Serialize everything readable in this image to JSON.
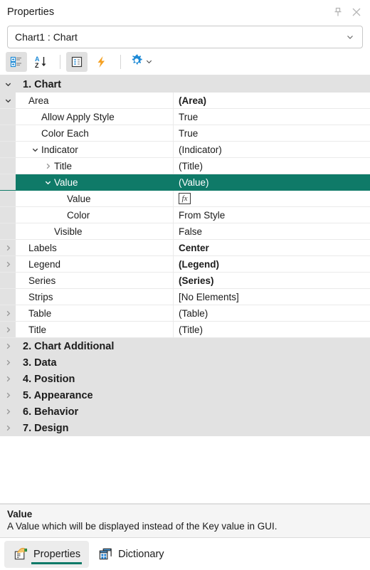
{
  "window": {
    "title": "Properties",
    "pin_icon": "pin-icon",
    "close_icon": "close-icon"
  },
  "object_selector": {
    "value": "Chart1 : Chart",
    "arrow_icon": "chevron-down-icon"
  },
  "toolbar": {
    "buttons": [
      {
        "name": "categorized-view",
        "icon": "categorized-list-icon",
        "active": true
      },
      {
        "name": "alphabetical-sort",
        "icon": "sort-az-icon",
        "active": false
      },
      {
        "name": "properties-view",
        "icon": "properties-list-icon",
        "active": true
      },
      {
        "name": "events-view",
        "icon": "lightning-icon",
        "active": false
      },
      {
        "name": "settings",
        "icon": "gear-icon",
        "active": false
      }
    ]
  },
  "grid": {
    "rows": [
      {
        "type": "category",
        "label": "1. Chart",
        "expanded": true
      },
      {
        "type": "prop",
        "indent": 0,
        "twisty": "expanded",
        "name": "Area",
        "value": "(Area)",
        "bold": true
      },
      {
        "type": "prop",
        "indent": 1,
        "twisty": "none",
        "name": "Allow Apply Style",
        "value": "True",
        "bold": false
      },
      {
        "type": "prop",
        "indent": 1,
        "twisty": "none",
        "name": "Color Each",
        "value": "True",
        "bold": false
      },
      {
        "type": "prop",
        "indent": 1,
        "twisty": "expanded",
        "name": "Indicator",
        "value": "(Indicator)",
        "bold": false
      },
      {
        "type": "prop",
        "indent": 2,
        "twisty": "collapsed",
        "name": "Title",
        "value": "(Title)",
        "bold": false
      },
      {
        "type": "prop",
        "indent": 2,
        "twisty": "expanded",
        "name": "Value",
        "value": "(Value)",
        "bold": false,
        "selected": true
      },
      {
        "type": "prop",
        "indent": 3,
        "twisty": "none",
        "name": "Value",
        "value": "",
        "editor": "fx",
        "bold": false
      },
      {
        "type": "prop",
        "indent": 3,
        "twisty": "none",
        "name": "Color",
        "value": "From Style",
        "bold": false
      },
      {
        "type": "prop",
        "indent": 2,
        "twisty": "none",
        "name": "Visible",
        "value": "False",
        "bold": false
      },
      {
        "type": "prop",
        "indent": 0,
        "twisty": "collapsed",
        "name": "Labels",
        "value": "Center",
        "bold": true
      },
      {
        "type": "prop",
        "indent": 0,
        "twisty": "collapsed",
        "name": "Legend",
        "value": "(Legend)",
        "bold": true
      },
      {
        "type": "prop",
        "indent": 0,
        "twisty": "none",
        "name": "Series",
        "value": "(Series)",
        "bold": true
      },
      {
        "type": "prop",
        "indent": 0,
        "twisty": "none",
        "name": "Strips",
        "value": "[No Elements]",
        "bold": false
      },
      {
        "type": "prop",
        "indent": 0,
        "twisty": "collapsed",
        "name": "Table",
        "value": "(Table)",
        "bold": false
      },
      {
        "type": "prop",
        "indent": 0,
        "twisty": "collapsed",
        "name": "Title",
        "value": "(Title)",
        "bold": false
      },
      {
        "type": "category",
        "label": "2. Chart  Additional",
        "expanded": false
      },
      {
        "type": "category",
        "label": "3. Data",
        "expanded": false
      },
      {
        "type": "category",
        "label": "4. Position",
        "expanded": false
      },
      {
        "type": "category",
        "label": "5. Appearance",
        "expanded": false
      },
      {
        "type": "category",
        "label": "6. Behavior",
        "expanded": false
      },
      {
        "type": "category",
        "label": "7. Design",
        "expanded": false
      }
    ],
    "fx_label": "fx"
  },
  "description": {
    "title": "Value",
    "text": "A Value which will be displayed instead of the Key value in GUI."
  },
  "tabs": [
    {
      "label": "Properties",
      "icon": "properties-tab-icon",
      "active": true
    },
    {
      "label": "Dictionary",
      "icon": "dictionary-tab-icon",
      "active": false
    }
  ],
  "colors": {
    "selection": "#0f7a68",
    "category_bg": "#e2e2e2",
    "accent_blue": "#1e8ad6",
    "accent_orange": "#f5a021"
  }
}
